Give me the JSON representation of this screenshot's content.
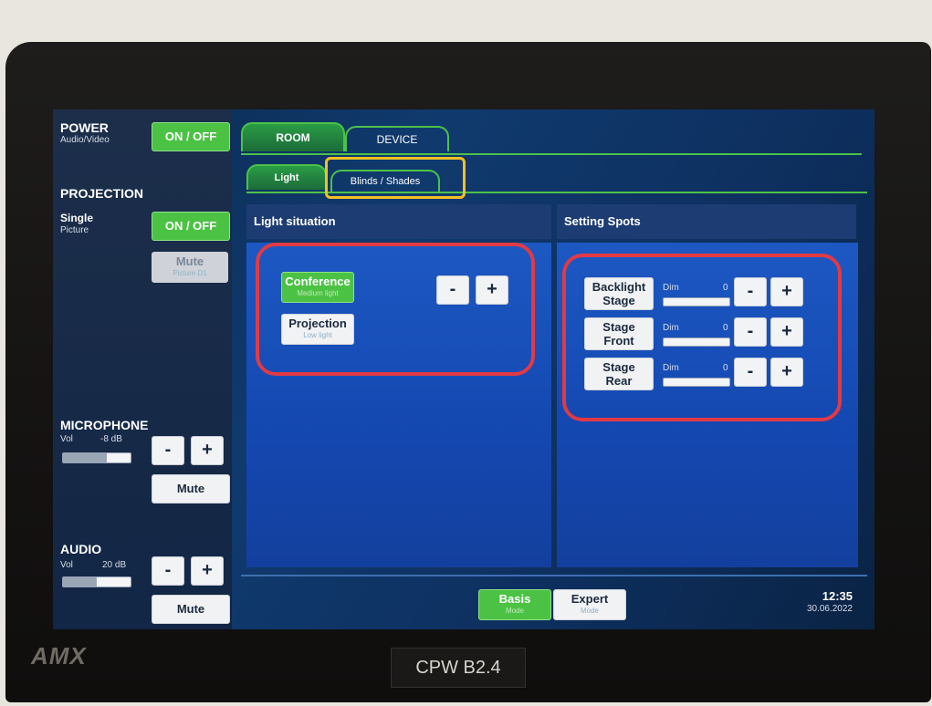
{
  "left": {
    "power": {
      "title": "POWER",
      "subtitle": "Audio/Video",
      "button": "ON / OFF"
    },
    "projection": {
      "title": "PROJECTION",
      "mode_label": "Single",
      "mode_sub": "Picture",
      "button": "ON / OFF",
      "mute_label": "Mute",
      "mute_sub": "Picture D1"
    },
    "microphone": {
      "title": "MICROPHONE",
      "vol_label": "Vol",
      "vol_value": "-8 dB",
      "vol_level": 0.65,
      "minus": "-",
      "plus": "+",
      "mute": "Mute"
    },
    "audio": {
      "title": "AUDIO",
      "vol_label": "Vol",
      "vol_value": "20 dB",
      "vol_level": 0.5,
      "minus": "-",
      "plus": "+",
      "mute": "Mute"
    }
  },
  "tabs": {
    "main": [
      "ROOM",
      "DEVICE"
    ],
    "sub": [
      "Light",
      "Blinds / Shades"
    ]
  },
  "light_situation": {
    "title": "Light situation",
    "presets": [
      {
        "label": "Conference",
        "sub": "Medium light"
      },
      {
        "label": "Projection",
        "sub": "Low light"
      }
    ],
    "minus": "-",
    "plus": "+"
  },
  "setting_spots": {
    "title": "Setting Spots",
    "spots": [
      {
        "line1": "Backlight",
        "line2": "Stage",
        "dim": "Dim",
        "value": "0"
      },
      {
        "line1": "Stage",
        "line2": "Front",
        "dim": "Dim",
        "value": "0"
      },
      {
        "line1": "Stage",
        "line2": "Rear",
        "dim": "Dim",
        "value": "0"
      }
    ],
    "minus": "-",
    "plus": "+"
  },
  "bottom": {
    "basis": "Basis",
    "basis_sub": "Mode",
    "expert": "Expert",
    "expert_sub": "Mode",
    "time": "12:35",
    "date": "30.06.2022"
  },
  "device": {
    "brand": "AMX",
    "room_label": "CPW B2.4"
  },
  "colors": {
    "accent_green": "#4cc245",
    "panel_blue": "#1d58c2",
    "highlight_red": "#e13a44",
    "highlight_yellow": "#f2c024"
  }
}
